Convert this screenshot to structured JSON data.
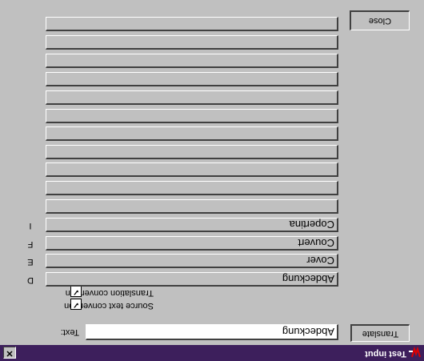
{
  "window": {
    "title": "Test input",
    "close_glyph": "✕",
    "icon": "app-icon"
  },
  "buttons": {
    "translate": "Translate",
    "close": "Close"
  },
  "text_field": {
    "label": "Text:",
    "value": "Abdeckung"
  },
  "checkboxes": [
    {
      "label": "Source text conversion",
      "checked": true,
      "mark": "✓"
    },
    {
      "label": "Translation conversion",
      "checked": true,
      "mark": "✓"
    }
  ],
  "results": [
    {
      "key": "D",
      "value": "Abdeckung"
    },
    {
      "key": "E",
      "value": "Cover"
    },
    {
      "key": "F",
      "value": "Couvert"
    },
    {
      "key": "I",
      "value": "Copertina"
    },
    {
      "key": "",
      "value": ""
    },
    {
      "key": "",
      "value": ""
    },
    {
      "key": "",
      "value": ""
    },
    {
      "key": "",
      "value": ""
    },
    {
      "key": "",
      "value": ""
    },
    {
      "key": "",
      "value": ""
    },
    {
      "key": "",
      "value": ""
    },
    {
      "key": "",
      "value": ""
    },
    {
      "key": "",
      "value": ""
    },
    {
      "key": "",
      "value": ""
    },
    {
      "key": "",
      "value": ""
    }
  ]
}
